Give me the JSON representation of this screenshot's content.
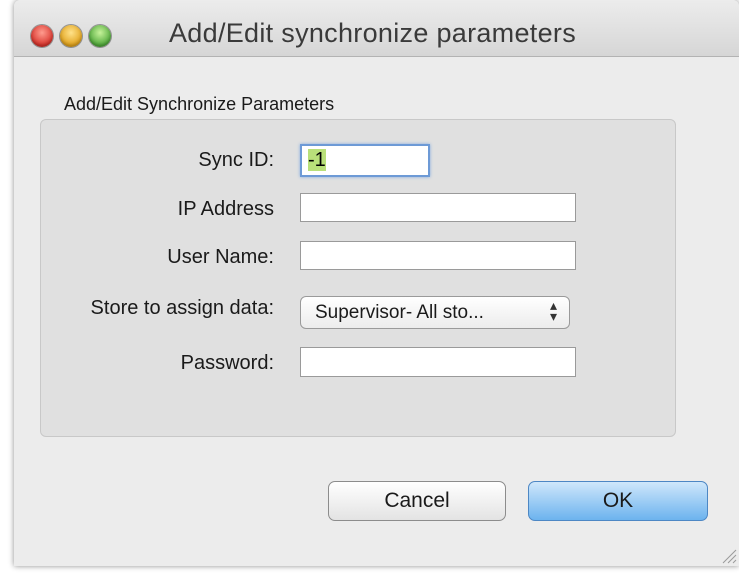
{
  "window": {
    "title": "Add/Edit synchronize parameters"
  },
  "group": {
    "label": "Add/Edit Synchronize Parameters"
  },
  "form": {
    "sync_id_label": "Sync ID:",
    "sync_id_value": "-1",
    "ip_label": "IP Address",
    "ip_value": "",
    "user_label": "User Name:",
    "user_value": "",
    "store_label": "Store to assign data:",
    "store_value": "Supervisor- All sto...",
    "password_label": "Password:",
    "password_value": ""
  },
  "buttons": {
    "cancel": "Cancel",
    "ok": "OK"
  },
  "icons": {
    "close": "close-icon",
    "minimize": "minimize-icon",
    "zoom": "zoom-icon",
    "popup_arrows": "up-down-arrows-icon",
    "resize": "resize-grip-icon"
  },
  "colors": {
    "ok_button": "#6cb3ee",
    "selection_highlight": "#b9e07a",
    "focus_ring": "#6d9ad6"
  }
}
